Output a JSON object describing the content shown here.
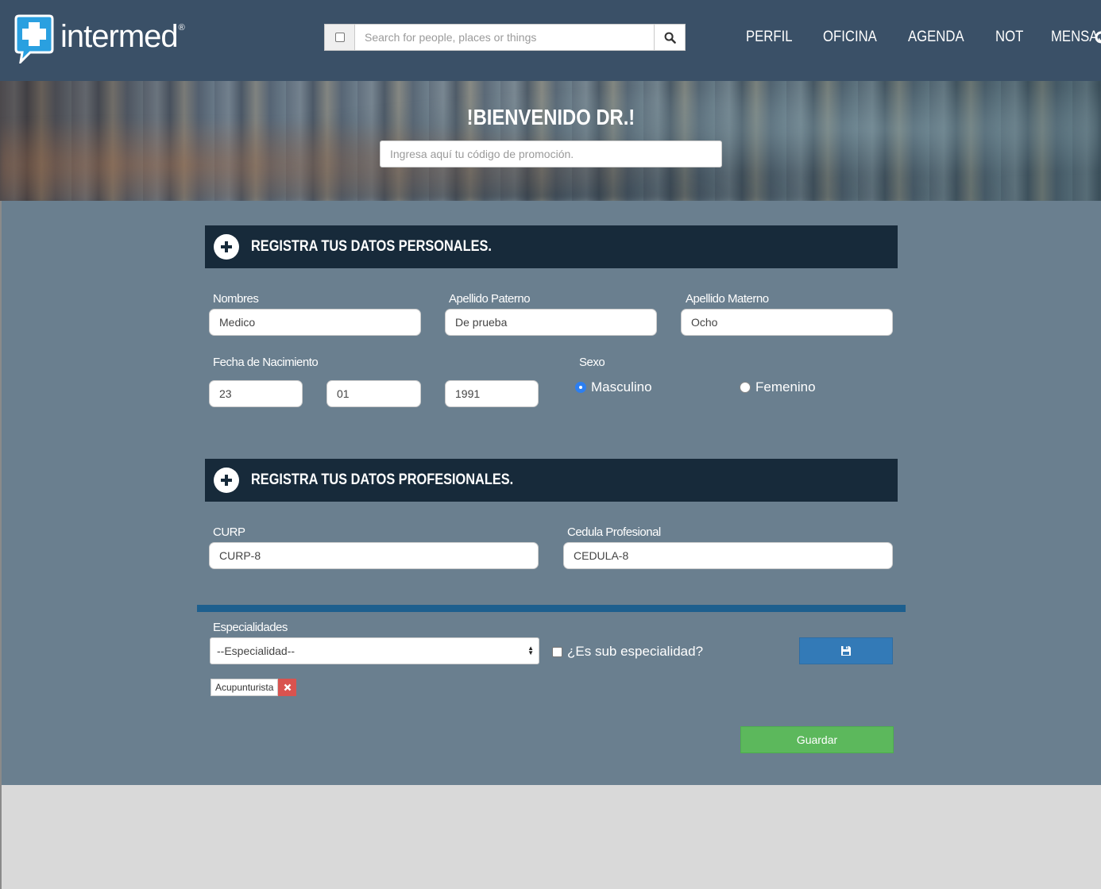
{
  "brand": {
    "name": "intermed",
    "reg": "®"
  },
  "search": {
    "placeholder": "Search for people, places or things"
  },
  "nav": {
    "items": [
      "PERFIL",
      "OFICINA",
      "AGENDA",
      "NOT",
      "MENSAJES"
    ]
  },
  "hero": {
    "title": "!BIENVENIDO DR.!",
    "promo_placeholder": "Ingresa aquí tu código de promoción."
  },
  "personal": {
    "title": "REGISTRA TUS DATOS PERSONALES.",
    "nombres_label": "Nombres",
    "nombres_value": "Medico",
    "paterno_label": "Apellido Paterno",
    "paterno_value": "De prueba",
    "materno_label": "Apellido Materno",
    "materno_value": "Ocho",
    "fecha_label": "Fecha de Nacimiento",
    "dia": "23",
    "mes": "01",
    "anio": "1991",
    "sexo_label": "Sexo",
    "masculino": "Masculino",
    "femenino": "Femenino",
    "sexo_selected": "Masculino"
  },
  "profesional": {
    "title": "REGISTRA TUS DATOS PROFESIONALES.",
    "curp_label": "CURP",
    "curp_value": "CURP-8",
    "cedula_label": "Cedula Profesional",
    "cedula_value": "CEDULA-8"
  },
  "especialidades": {
    "label": "Especialidades",
    "select_value": "--Especialidad--",
    "sub_label": "¿Es sub especialidad?",
    "tags": [
      "Acupunturista"
    ]
  },
  "actions": {
    "guardar": "Guardar"
  },
  "colors": {
    "header": "#3a5067",
    "panel": "#6a7f8f",
    "section": "#172a3a",
    "primary": "#337ab7",
    "success": "#5cb85c",
    "danger": "#d9534f"
  }
}
